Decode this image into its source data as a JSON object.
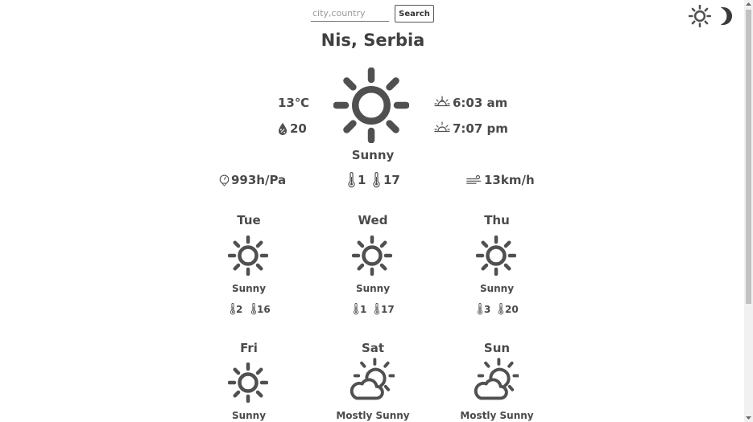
{
  "search": {
    "placeholder": "city,country",
    "value": "",
    "button_label": "Search"
  },
  "header_icons": {
    "theme_light": "sun-icon",
    "theme_dark": "moon-icon"
  },
  "location": "Nis, Serbia",
  "current": {
    "temperature": "13℃",
    "humidity": "20",
    "condition": "Sunny",
    "sunrise": "6:03 am",
    "sunset": "7:07 pm",
    "pressure": "993h/Pa",
    "temp_min": "1",
    "temp_max": "17",
    "wind": "13km/h"
  },
  "forecast": [
    {
      "day": "Tue",
      "condition": "Sunny",
      "min": "2",
      "max": "16",
      "icon": "sun-icon"
    },
    {
      "day": "Wed",
      "condition": "Sunny",
      "min": "1",
      "max": "17",
      "icon": "sun-icon"
    },
    {
      "day": "Thu",
      "condition": "Sunny",
      "min": "3",
      "max": "20",
      "icon": "sun-icon"
    },
    {
      "day": "Fri",
      "condition": "Sunny",
      "icon": "sun-icon"
    },
    {
      "day": "Sat",
      "condition": "Mostly Sunny",
      "icon": "mostly-sunny-icon"
    },
    {
      "day": "Sun",
      "condition": "Mostly Sunny",
      "icon": "mostly-sunny-icon"
    }
  ],
  "colors": {
    "icon": "#505050",
    "text": "#4a4a4a",
    "background": "#ffffff"
  }
}
